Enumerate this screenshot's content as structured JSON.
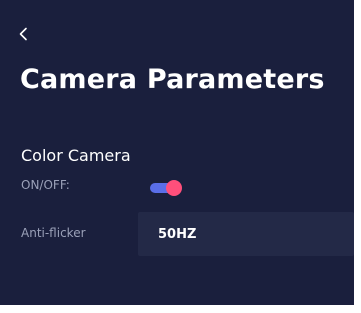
{
  "header": {
    "back_icon": "chevron-left-icon",
    "title": "Camera Parameters"
  },
  "color_camera": {
    "section_title": "Color Camera",
    "onoff_label": "ON/OFF:",
    "onoff_state": true,
    "anti_flicker_label": "Anti-flicker",
    "anti_flicker_value": "50HZ"
  },
  "colors": {
    "background": "#1a1f3d",
    "field_background": "#232947",
    "toggle_track": "#5a6ee8",
    "toggle_knob": "#ff4f7b",
    "muted_text": "#9aa0b8"
  }
}
